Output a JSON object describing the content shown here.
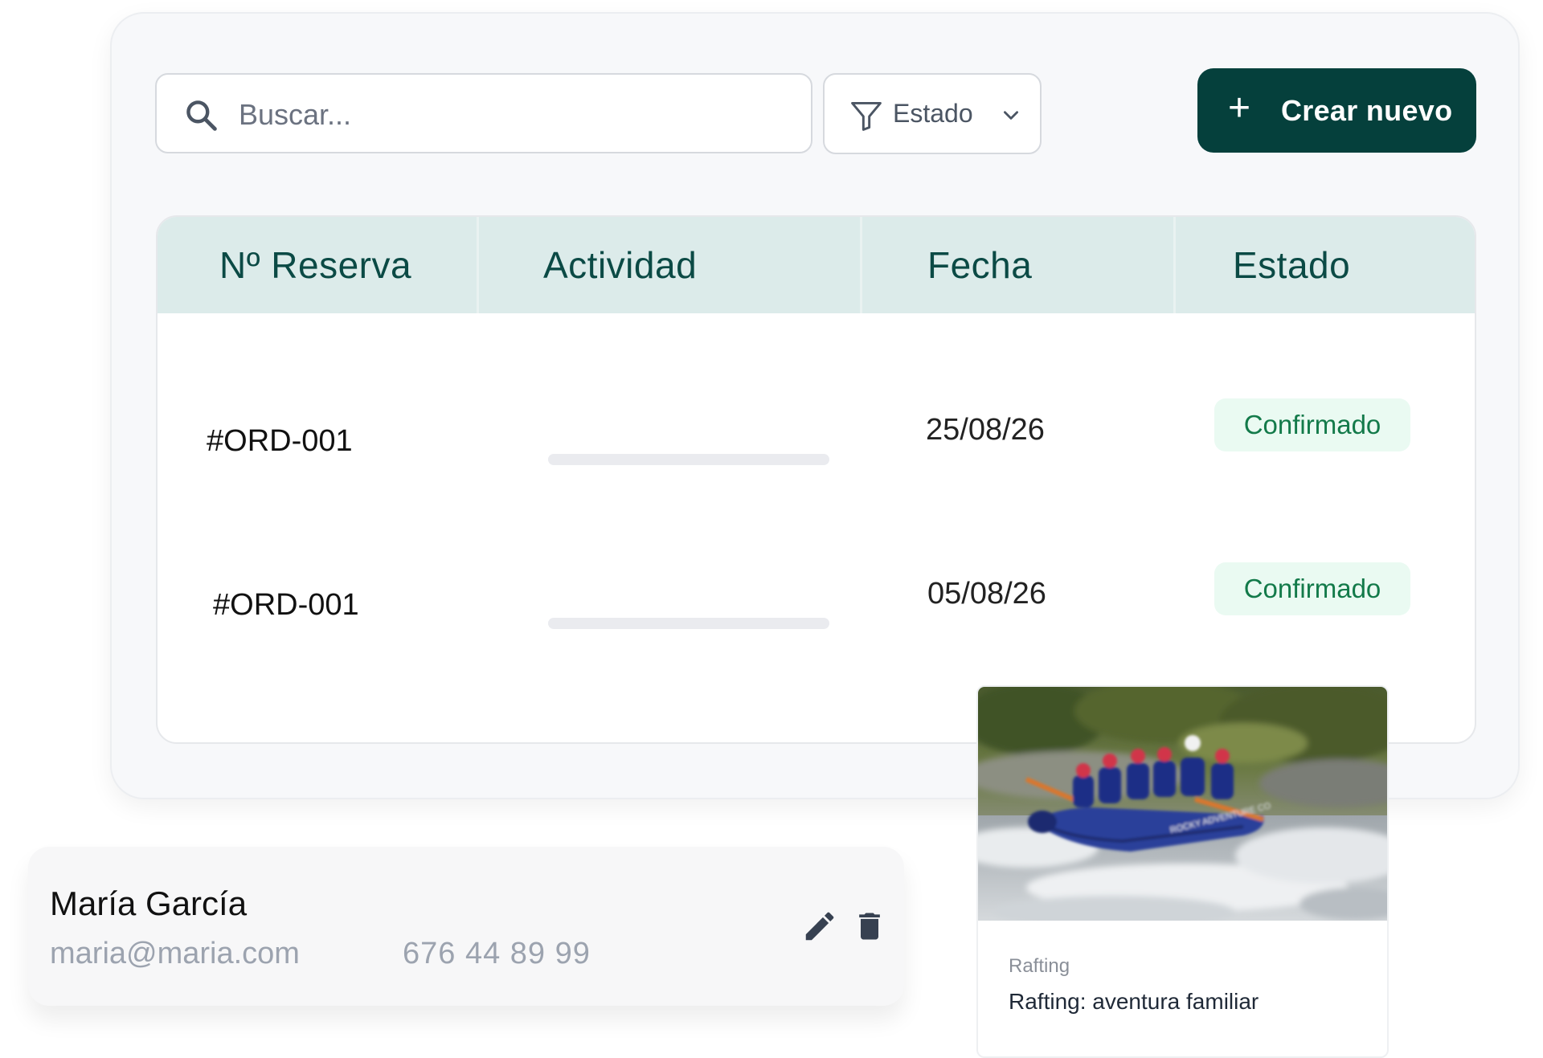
{
  "search": {
    "placeholder": "Buscar..."
  },
  "filter": {
    "label": "Estado"
  },
  "actions": {
    "create_label": "Crear nuevo",
    "create_icon": "plus-icon"
  },
  "table": {
    "columns": [
      "Nº Reserva",
      "Actividad",
      "Fecha",
      "Estado"
    ],
    "rows": [
      {
        "id": "#ORD-001",
        "date": "25/08/26",
        "status": "Confirmado"
      },
      {
        "id": "#ORD-001",
        "date": "05/08/26",
        "status": "Confirmado"
      }
    ]
  },
  "contact": {
    "name": "María García",
    "email": "maria@maria.com",
    "phone": "676 44 89 99"
  },
  "activity_card": {
    "category": "Rafting",
    "title": "Rafting: aventura familiar",
    "photo_text": "ROCKY ADVENTURE CO"
  },
  "colors": {
    "primary": "#05403c",
    "header_bg": "#dcebea",
    "header_text": "#0b4a45",
    "badge_bg": "#eafaf2",
    "badge_text": "#137a4a"
  }
}
